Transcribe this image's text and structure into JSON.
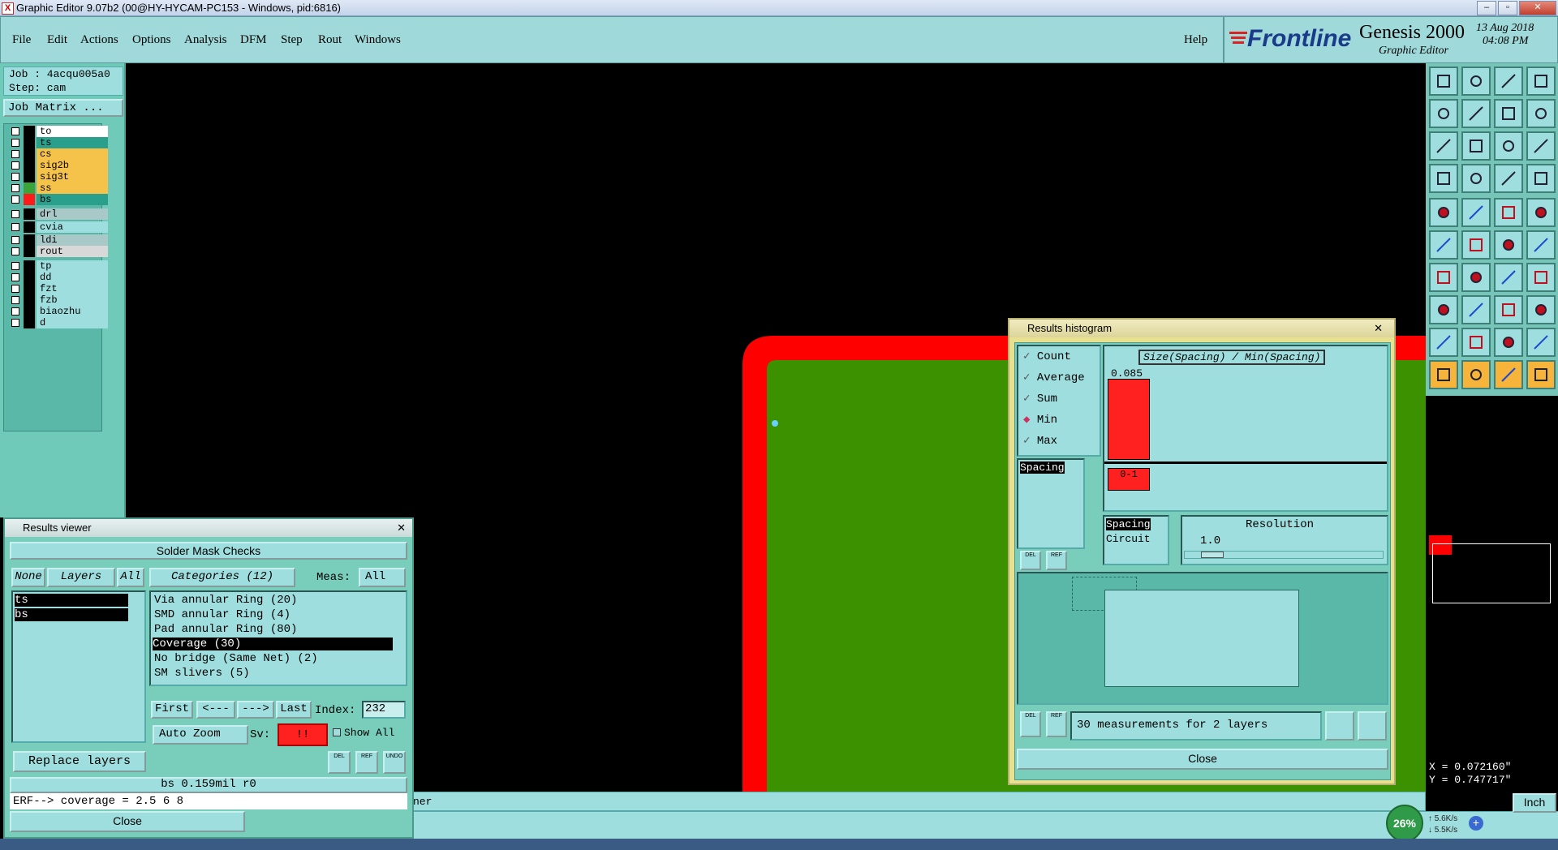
{
  "window": {
    "title": "Graphic Editor 9.07b2 (00@HY-HYCAM-PC153 - Windows, pid:6816)",
    "app_icon": "X"
  },
  "menu": {
    "items": [
      "File",
      "Edit",
      "Actions",
      "Options",
      "Analysis",
      "DFM",
      "Step",
      "Rout",
      "Windows"
    ],
    "help": "Help"
  },
  "brand": {
    "logo": "Frontline",
    "product": "Genesis 2000",
    "subtitle": "Graphic Editor",
    "date": "13 Aug 2018",
    "time": "04:08 PM"
  },
  "job": {
    "job": "Job : 4acqu005a0",
    "step": "Step: cam",
    "matrix_button": "Job Matrix ..."
  },
  "layers": [
    {
      "name": "to",
      "color": "#ffffff",
      "swatch": "#000000"
    },
    {
      "name": "ts",
      "color": "#2aa08c",
      "swatch": "#000000"
    },
    {
      "name": "cs",
      "color": "#f6c34a",
      "swatch": "#000000"
    },
    {
      "name": "sig2b",
      "color": "#f6c34a",
      "swatch": "#000000"
    },
    {
      "name": "sig3t",
      "color": "#f6c34a",
      "swatch": "#000000"
    },
    {
      "name": "ss",
      "color": "#f6c34a",
      "swatch": "#3aa33a"
    },
    {
      "name": "bs",
      "color": "#2aa08c",
      "swatch": "#ff1a1a"
    },
    {
      "name": "drl",
      "color": "#a9c8c8",
      "swatch": "#000000"
    },
    {
      "name": "cvia",
      "color": "#9fdede",
      "swatch": "#000000"
    },
    {
      "name": "ldi",
      "color": "#a9c8c8",
      "swatch": "#000000"
    },
    {
      "name": "rout",
      "color": "#d8d8d8",
      "swatch": "#000000"
    },
    {
      "name": "tp",
      "color": "#9fdede",
      "swatch": "#000000"
    },
    {
      "name": "dd",
      "color": "#9fdede",
      "swatch": "#000000"
    },
    {
      "name": "fzt",
      "color": "#9fdede",
      "swatch": "#000000"
    },
    {
      "name": "fzb",
      "color": "#9fdede",
      "swatch": "#000000"
    },
    {
      "name": "biaozhu",
      "color": "#9fdede",
      "swatch": "#000000"
    },
    {
      "name": "d",
      "color": "#9fdede",
      "swatch": "#000000"
    }
  ],
  "results_viewer": {
    "title": "Results viewer",
    "header": "Solder Mask Checks",
    "none_btn": "None",
    "layers_label": "Layers",
    "all_btn": "All",
    "categories_label": "Categories (12)",
    "meas_label": "Meas:",
    "meas_value": "All",
    "layer_list": [
      "ts",
      "bs"
    ],
    "categories": [
      "Via annular Ring (20)",
      "SMD annular Ring (4)",
      "Pad annular Ring (80)",
      "Coverage (30)",
      "No bridge (Same Net) (2)",
      "SM slivers (5)"
    ],
    "selected_category": "Coverage (30)",
    "nav": {
      "first": "First",
      "prev": "<---",
      "next": "--->",
      "last": "Last",
      "index_label": "Index:",
      "index_value": "232"
    },
    "auto_zoom": "Auto Zoom",
    "sv_label": "Sv:",
    "sv_value": "!!",
    "show_all": "Show All",
    "replace_layers": "Replace layers",
    "small_btns": [
      "DEL",
      "REF",
      "UNDO"
    ],
    "info": "bs 0.159mil  r0",
    "erf": "ERF--> coverage = 2.5 6 8",
    "close": "Close"
  },
  "histogram": {
    "title": "Results histogram",
    "modes": [
      "Count",
      "Average",
      "Sum",
      "Min",
      "Max"
    ],
    "selected_mode": "Min",
    "chart_title": "Size(Spacing) / Min(Spacing)",
    "bar_value": "0.085",
    "bar_label": "0-1",
    "left_list": [
      "Spacing"
    ],
    "list2": [
      "Spacing",
      "Circuit"
    ],
    "resolution_label": "Resolution",
    "resolution_value": "1.0",
    "measurements": "30 measurements for 2 layers",
    "close": "Close",
    "small_btns": [
      "DEL",
      "REF"
    ]
  },
  "status": {
    "text": "ner",
    "coord_x": "X = 0.072160\"",
    "coord_y": "Y = 0.747717\"",
    "units": "Inch"
  },
  "tray": {
    "percent": "26%",
    "up": "5.6K/s",
    "down": "5.5K/s"
  },
  "colors": {
    "teal": "#9fdede",
    "panel": "#78cdbb",
    "copper_red": "#ff0000",
    "board_green": "#3c9100"
  }
}
